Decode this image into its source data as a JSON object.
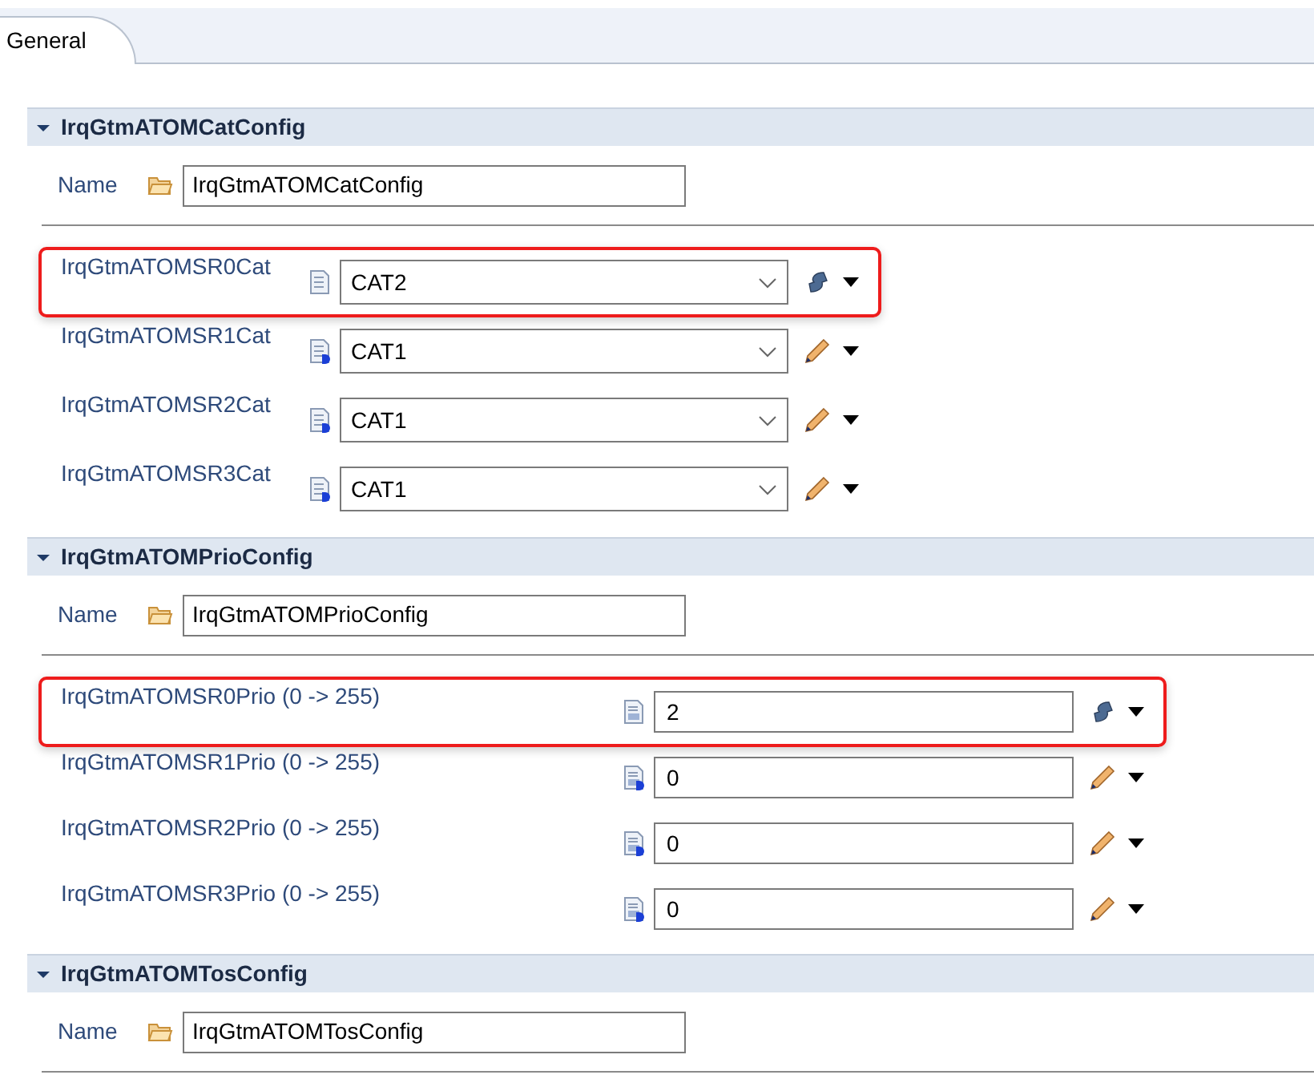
{
  "tabs": [
    {
      "label": "General",
      "selected": true
    }
  ],
  "sections": [
    {
      "title": "IrqGtmATOMCatConfig",
      "expanded": true,
      "name_label": "Name",
      "name_value": "IrqGtmATOMCatConfig",
      "params": [
        {
          "kind": "combo",
          "label": "IrqGtmATOMSR0Cat",
          "value": "CAT2",
          "highlighted": true,
          "calculated": true
        },
        {
          "kind": "combo",
          "label": "IrqGtmATOMSR1Cat",
          "value": "CAT1",
          "highlighted": false,
          "calculated": false
        },
        {
          "kind": "combo",
          "label": "IrqGtmATOMSR2Cat",
          "value": "CAT1",
          "highlighted": false,
          "calculated": false
        },
        {
          "kind": "combo",
          "label": "IrqGtmATOMSR3Cat",
          "value": "CAT1",
          "highlighted": false,
          "calculated": false
        }
      ]
    },
    {
      "title": "IrqGtmATOMPrioConfig",
      "expanded": true,
      "name_label": "Name",
      "name_value": "IrqGtmATOMPrioConfig",
      "params": [
        {
          "kind": "number",
          "label": "IrqGtmATOMSR0Prio (0 -> 255)",
          "value": "2",
          "highlighted": true,
          "calculated": true
        },
        {
          "kind": "number",
          "label": "IrqGtmATOMSR1Prio (0 -> 255)",
          "value": "0",
          "highlighted": false,
          "calculated": false
        },
        {
          "kind": "number",
          "label": "IrqGtmATOMSR2Prio (0 -> 255)",
          "value": "0",
          "highlighted": false,
          "calculated": false
        },
        {
          "kind": "number",
          "label": "IrqGtmATOMSR3Prio (0 -> 255)",
          "value": "0",
          "highlighted": false,
          "calculated": false
        }
      ]
    },
    {
      "title": "IrqGtmATOMTosConfig",
      "expanded": true,
      "name_label": "Name",
      "name_value": "IrqGtmATOMTosConfig"
    }
  ]
}
